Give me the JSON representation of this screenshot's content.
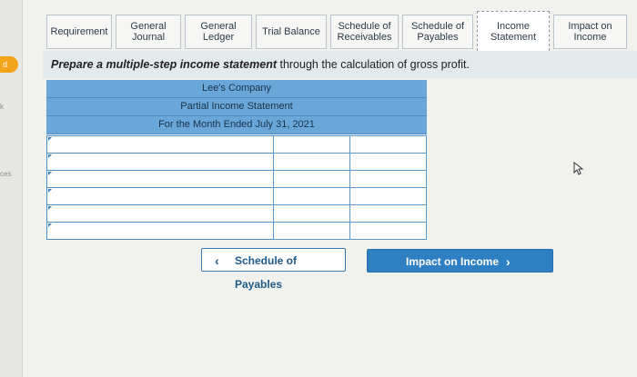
{
  "sidebar": {
    "badge": "d",
    "items": [
      "k",
      "ces"
    ]
  },
  "tabs": [
    {
      "label": "Requirement"
    },
    {
      "label": "General\nJournal"
    },
    {
      "label": "General\nLedger"
    },
    {
      "label": "Trial Balance"
    },
    {
      "label": "Schedule of\nReceivables"
    },
    {
      "label": "Schedule of\nPayables"
    },
    {
      "label": "Income\nStatement",
      "active": true
    },
    {
      "label": "Impact on\nIncome"
    }
  ],
  "instruction": {
    "lead": "Prepare a multiple-step income statement",
    "rest": " through the calculation of gross profit."
  },
  "statement": {
    "company": "Lee's Company",
    "title": "Partial Income Statement",
    "period": "For the Month Ended July 31, 2021",
    "rows": [
      [
        "",
        "",
        ""
      ],
      [
        "",
        "",
        ""
      ],
      [
        "",
        "",
        ""
      ],
      [
        "",
        "",
        ""
      ],
      [
        "",
        "",
        ""
      ],
      [
        "",
        "",
        ""
      ]
    ]
  },
  "nav": {
    "prev_label": "Schedule of Payables",
    "prev_arrow": "‹",
    "next_label": "Impact on Income",
    "next_arrow": "›"
  },
  "colors": {
    "header_blue": "#6aa7d8",
    "button_blue": "#2f7fc3",
    "accent_orange": "#f4a41b"
  }
}
